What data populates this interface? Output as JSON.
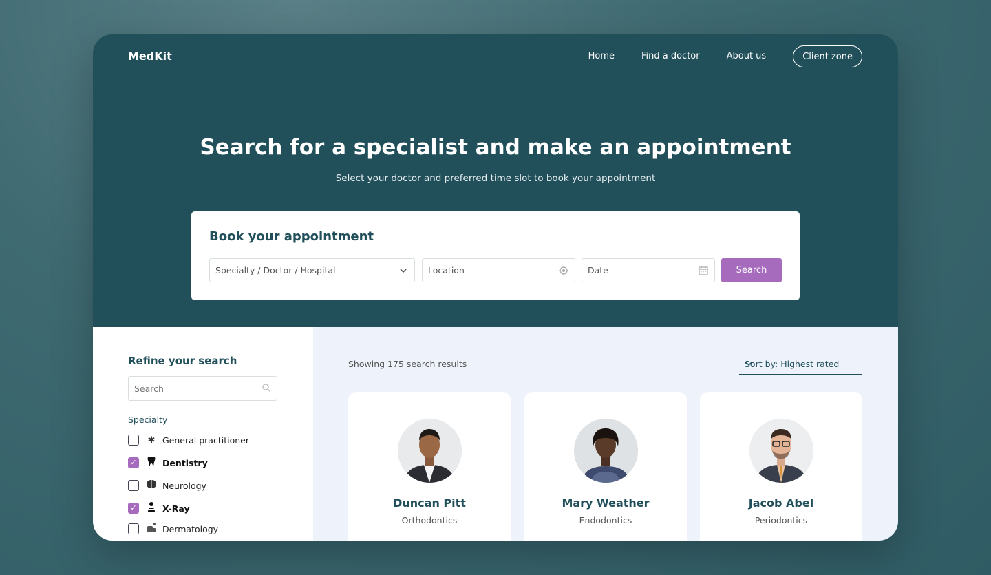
{
  "header": {
    "logo": "MedKit",
    "nav": [
      "Home",
      "Find a doctor",
      "About us"
    ],
    "client_zone": "Client zone"
  },
  "hero": {
    "title": "Search for a specialist and make an appointment",
    "subtitle": "Select your doctor and preferred time slot to book your appointment"
  },
  "booking": {
    "title": "Book your appointment",
    "specialty_placeholder": "Specialty / Doctor / Hospital",
    "location_placeholder": "Location",
    "date_placeholder": "Date",
    "search_label": "Search"
  },
  "sidebar": {
    "title": "Refine your search",
    "search_placeholder": "Search",
    "specialty_label": "Specialty",
    "specialties": [
      {
        "label": "General practitioner",
        "checked": false,
        "icon": "asterisk-icon"
      },
      {
        "label": "Dentistry",
        "checked": true,
        "icon": "tooth-icon"
      },
      {
        "label": "Neurology",
        "checked": false,
        "icon": "brain-icon"
      },
      {
        "label": "X-Ray",
        "checked": true,
        "icon": "xray-icon"
      },
      {
        "label": "Dermatology",
        "checked": false,
        "icon": "skin-icon"
      }
    ]
  },
  "results": {
    "showing": "Showing 175 search results",
    "sort": "Sort by: Highest rated",
    "doctors": [
      {
        "name": "Duncan Pitt",
        "specialty": "Orthodontics"
      },
      {
        "name": "Mary Weather",
        "specialty": "Endodontics"
      },
      {
        "name": "Jacob Abel",
        "specialty": "Periodontics"
      }
    ]
  },
  "colors": {
    "primary": "#214f5a",
    "accent": "#a66bbd",
    "results_bg": "#eef3fb"
  }
}
